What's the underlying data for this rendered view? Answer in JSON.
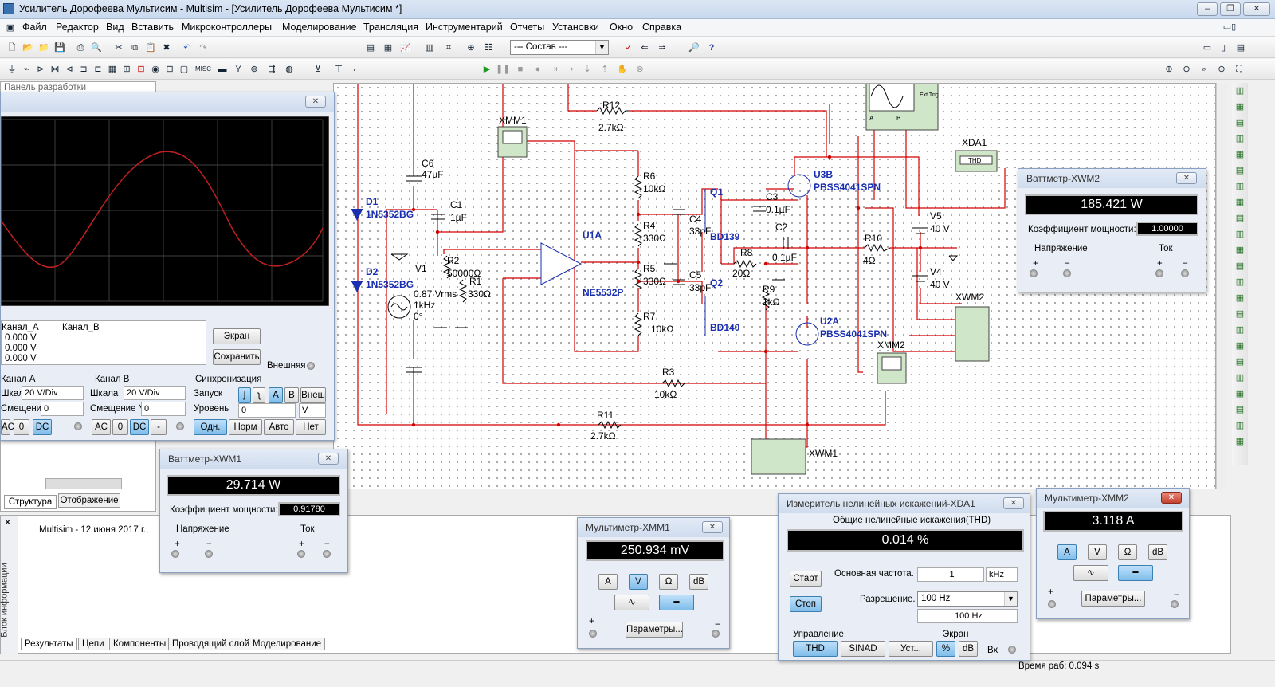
{
  "app": {
    "title": "Усилитель Дорофеева Мультисим - Multisim - [Усилитель Дорофеева Мультисим *]"
  },
  "menu": [
    "Файл",
    "Редактор",
    "Вид",
    "Вставить",
    "Микроконтроллеры",
    "Моделирование",
    "Трансляция",
    "Инструментарий",
    "Отчеты",
    "Установки",
    "Окно",
    "Справка"
  ],
  "toolbar": {
    "combo": "--- Состав ---"
  },
  "left_panel": {
    "title": "Панель разработки",
    "tabs": [
      "Структура",
      "Отображение"
    ]
  },
  "circuit": {
    "labels": {
      "r12": "R12",
      "r12v": "2.7kΩ",
      "xmm1": "XMM1",
      "c6": "C6",
      "c6v": "47µF",
      "d1": "D1",
      "d1v": "1N5352BG",
      "d2": "D2",
      "d2v": "1N5352BG",
      "c1": "C1",
      "c1v": "1µF",
      "v1": "V1",
      "v1a": "0.87 Vrms",
      "v1b": "1kHz",
      "v1c": "0°",
      "r2": "R2",
      "r2v": "50000Ω",
      "r1": "R1",
      "r1v": "330Ω",
      "u1a": "U1A",
      "u1b": "NE5532P",
      "r6": "R6",
      "r6v": "10kΩ",
      "r4": "R4",
      "r4v": "330Ω",
      "r5": "R5",
      "r5v": "330Ω",
      "r7": "R7",
      "r7v": "10kΩ",
      "c4": "C4",
      "c4v": "33pF",
      "c5": "C5",
      "c5v": "33pF",
      "q1": "Q1",
      "q1v": "BD139",
      "q2": "Q2",
      "q2v": "BD140",
      "c3": "C3",
      "c3v": "0.1µF",
      "c2": "C2",
      "c2v": "0.1µF",
      "r8": "R8",
      "r8v": "20Ω",
      "r9": "R9",
      "r9v": "1kΩ",
      "u3b": "U3B",
      "u3bv": "PBSS4041SPN",
      "u2a": "U2A",
      "u2av": "PBSS4041SPN",
      "xda1": "XDA1",
      "thd": "THD",
      "v5": "V5",
      "v5v": "40 V",
      "v4": "V4",
      "v4v": "40 V",
      "r10": "R10",
      "r10v": "4Ω",
      "xwm2": "XWM2",
      "xmm2": "XMM2",
      "r3": "R3",
      "r3v": "10kΩ",
      "r11": "R11",
      "r11v": "2.7kΩ",
      "xwm1": "XWM1",
      "ext": "Ext Trig",
      "sa": "A",
      "sb": "B"
    }
  },
  "scope": {
    "chA": "Канал_A",
    "chB": "Канал_B",
    "vals": [
      "0.000 V",
      "0.000 V",
      "0.000 V"
    ],
    "btn_screen": "Экран",
    "btn_save": "Сохранить",
    "ext": "Внешняя",
    "chanA": {
      "title": "Канал A",
      "scale_lbl": "Шкала",
      "scale": "20  V/Div",
      "off_lbl": "Смещение Y",
      "off": "0",
      "btns": [
        "AC",
        "0",
        "DC"
      ]
    },
    "chanB": {
      "title": "Канал B",
      "scale_lbl": "Шкала",
      "scale": "20  V/Div",
      "off_lbl": "Смещение Y",
      "off": "0",
      "btns": [
        "AC",
        "0",
        "DC",
        "-"
      ]
    },
    "sync": {
      "title": "Синхронизация",
      "start": "Запуск",
      "ab": [
        "A",
        "B"
      ],
      "ext": "Внеш",
      "level": "Уровень",
      "level_val": "0",
      "unit": "V",
      "modes": [
        "Одн.",
        "Норм",
        "Авто",
        "Нет"
      ]
    }
  },
  "wm1": {
    "title": "Ваттметр-XWM1",
    "power": "29.714 W",
    "pf_lbl": "Коэффициент мощности:",
    "pf": "0.91780",
    "v": "Напряжение",
    "i": "Ток"
  },
  "wm2": {
    "title": "Ваттметр-XWM2",
    "power": "185.421 W",
    "pf_lbl": "Коэффициент мощности:",
    "pf": "1.00000",
    "v": "Напряжение",
    "i": "Ток"
  },
  "mm1": {
    "title": "Мультиметр-XMM1",
    "value": "250.934 mV",
    "btns": [
      "A",
      "V",
      "Ω",
      "dB"
    ],
    "params": "Параметры..."
  },
  "mm2": {
    "title": "Мультиметр-XMM2",
    "value": "3.118 A",
    "btns": [
      "A",
      "V",
      "Ω",
      "dB"
    ],
    "params": "Параметры..."
  },
  "xda": {
    "title": "Измеритель нелинейных искажений-XDA1",
    "sub": "Общие нелинейные искажения(THD)",
    "value": "0.014 %",
    "start": "Старт",
    "stop": "Стоп",
    "freq_lbl": "Основная частота.",
    "freq": "1",
    "freq_unit": "kHz",
    "res_lbl": "Разрешение.",
    "res": "100 Hz",
    "res2": "100 Hz",
    "ctrl": "Управление",
    "screen": "Экран",
    "ctrl_btns": [
      "THD",
      "SINAD",
      "Уст..."
    ],
    "scr_btns": [
      "%",
      "dB"
    ],
    "in": "Вх"
  },
  "info": {
    "log": "Multisim  -  12 июня 2017 г.,",
    "side": "Блок информации",
    "tabs": [
      "Результаты",
      "Цепи",
      "Компоненты",
      "Проводящий слой",
      "Моделирование"
    ]
  },
  "status": "Время раб: 0.094 s"
}
